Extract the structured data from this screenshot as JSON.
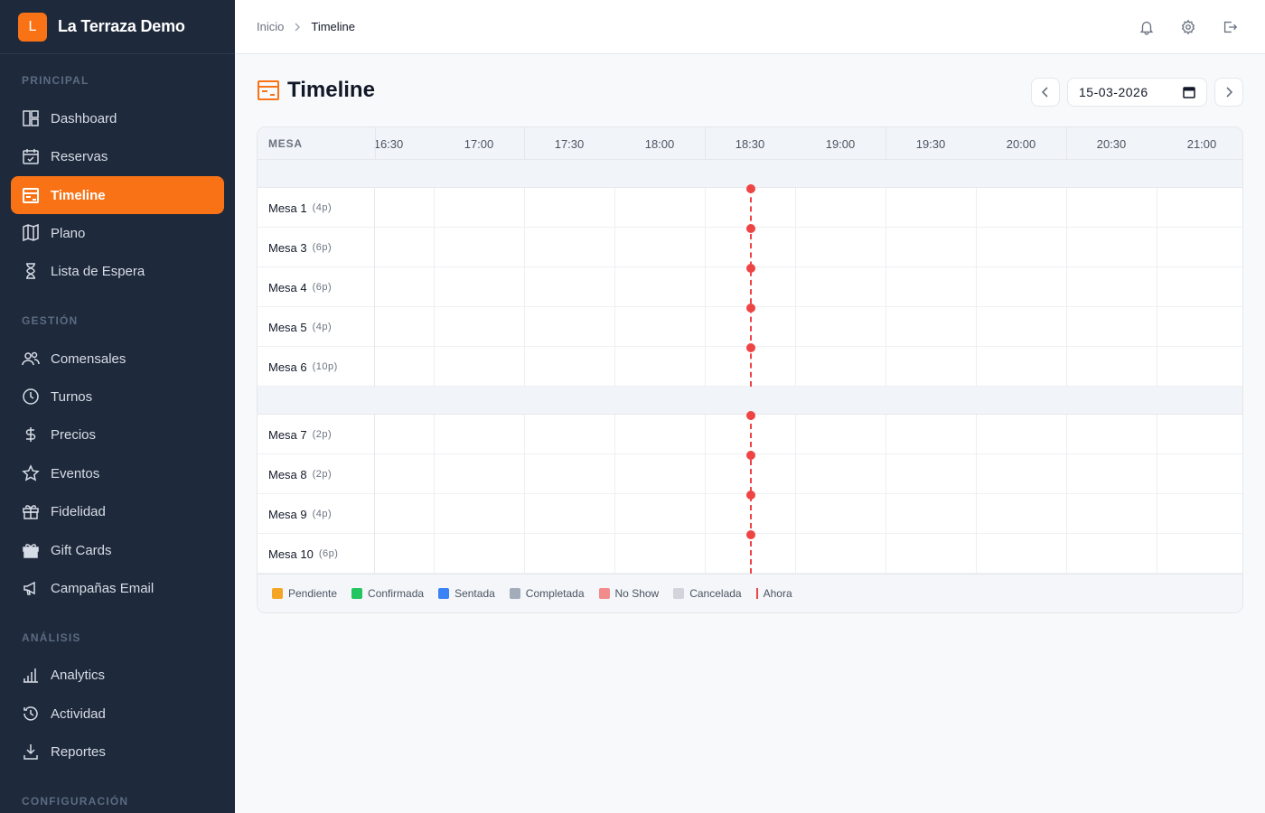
{
  "app": {
    "logo_letter": "L",
    "name": "La Terraza Demo"
  },
  "sidebar": {
    "sections": [
      {
        "label": "PRINCIPAL"
      },
      {
        "label": "GESTIÓN"
      },
      {
        "label": "ANÁLISIS"
      },
      {
        "label": "CONFIGURACIÓN"
      }
    ],
    "items": [
      {
        "label": "Dashboard",
        "icon": "dashboard-icon"
      },
      {
        "label": "Reservas",
        "icon": "calendar-check-icon"
      },
      {
        "label": "Timeline",
        "icon": "timeline-icon",
        "active": true
      },
      {
        "label": "Plano",
        "icon": "map-icon"
      },
      {
        "label": "Lista de Espera",
        "icon": "hourglass-icon"
      },
      {
        "label": "Comensales",
        "icon": "users-icon"
      },
      {
        "label": "Turnos",
        "icon": "clock-icon"
      },
      {
        "label": "Precios",
        "icon": "dollar-icon"
      },
      {
        "label": "Eventos",
        "icon": "star-icon"
      },
      {
        "label": "Fidelidad",
        "icon": "gift-icon"
      },
      {
        "label": "Gift Cards",
        "icon": "gift-card-icon"
      },
      {
        "label": "Campañas Email",
        "icon": "megaphone-icon"
      },
      {
        "label": "Analytics",
        "icon": "bar-chart-icon"
      },
      {
        "label": "Actividad",
        "icon": "activity-clock-icon"
      },
      {
        "label": "Reportes",
        "icon": "download-icon"
      }
    ]
  },
  "breadcrumb": {
    "home": "Inicio",
    "current": "Timeline"
  },
  "page": {
    "title": "Timeline"
  },
  "date_picker": {
    "value": "15-03-2026"
  },
  "timeline": {
    "mesa_header": "MESA",
    "times": [
      "16:30",
      "17:00",
      "17:30",
      "18:00",
      "18:30",
      "19:00",
      "19:30",
      "20:00",
      "20:30",
      "21:00"
    ],
    "groups": [
      {
        "tables": [
          {
            "name": "Mesa 1",
            "capacity": "(4p)"
          },
          {
            "name": "Mesa 3",
            "capacity": "(6p)"
          },
          {
            "name": "Mesa 4",
            "capacity": "(6p)"
          },
          {
            "name": "Mesa 5",
            "capacity": "(4p)"
          },
          {
            "name": "Mesa 6",
            "capacity": "(10p)"
          }
        ]
      },
      {
        "tables": [
          {
            "name": "Mesa 7",
            "capacity": "(2p)"
          },
          {
            "name": "Mesa 8",
            "capacity": "(2p)"
          },
          {
            "name": "Mesa 9",
            "capacity": "(4p)"
          },
          {
            "name": "Mesa 10",
            "capacity": "(6p)"
          }
        ]
      }
    ],
    "now_color": "#ef4444"
  },
  "legend": [
    {
      "label": "Pendiente",
      "color": "#f5a524"
    },
    {
      "label": "Confirmada",
      "color": "#22c55e"
    },
    {
      "label": "Sentada",
      "color": "#3b82f6"
    },
    {
      "label": "Completada",
      "color": "#a3acb9"
    },
    {
      "label": "No Show",
      "color": "#f28b8b"
    },
    {
      "label": "Cancelada",
      "color": "#d1d5db"
    },
    {
      "label": "Ahora",
      "color": "#ef4444",
      "is_now": true
    }
  ]
}
